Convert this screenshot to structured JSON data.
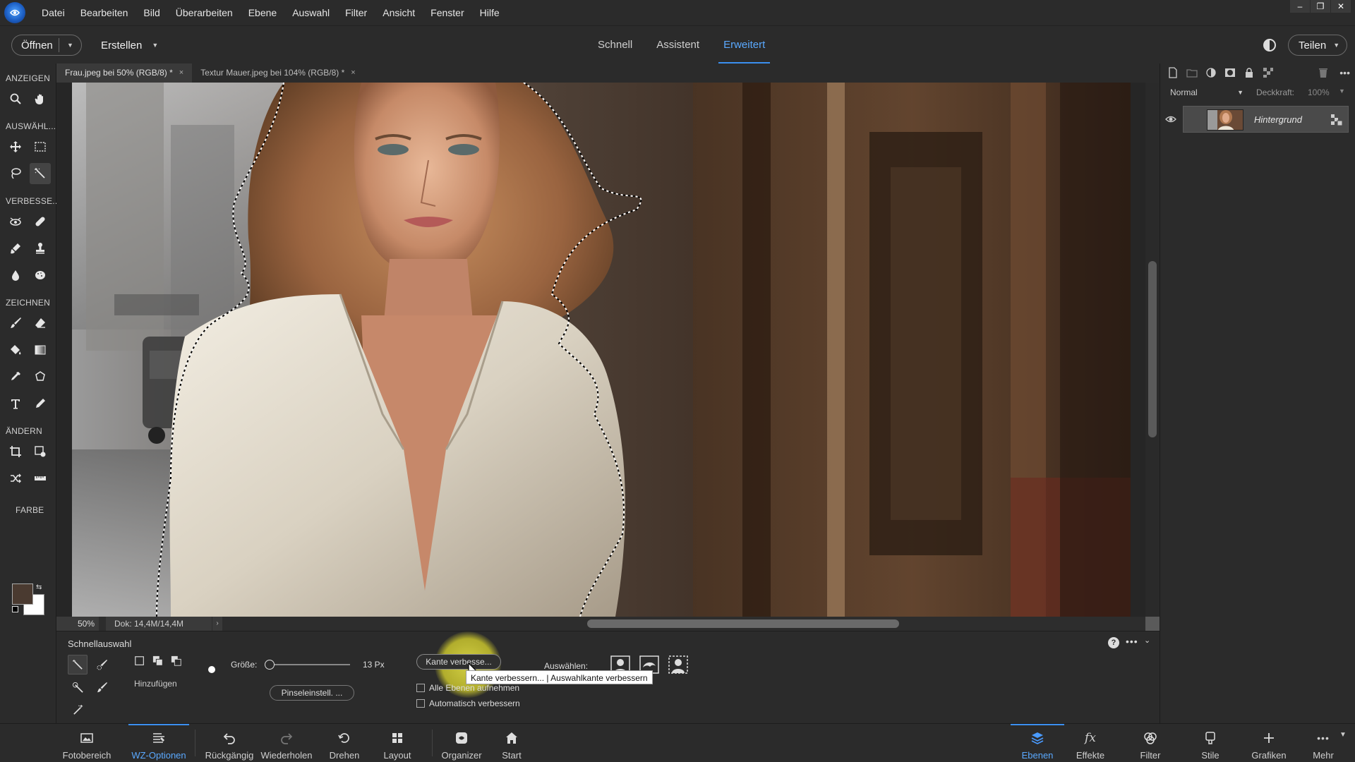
{
  "menubar": {
    "items": [
      "Datei",
      "Bearbeiten",
      "Bild",
      "Überarbeiten",
      "Ebene",
      "Auswahl",
      "Filter",
      "Ansicht",
      "Fenster",
      "Hilfe"
    ],
    "window_controls": [
      "–",
      "❐",
      "✕"
    ]
  },
  "modebar": {
    "open_label": "Öffnen",
    "create_label": "Erstellen",
    "tabs": [
      "Schnell",
      "Assistent",
      "Erweitert"
    ],
    "active_tab": "Erweitert",
    "share_label": "Teilen"
  },
  "toolbox": {
    "sections": [
      "ANZEIGEN",
      "AUSWÄHL...",
      "VERBESSE...",
      "ZEICHNEN",
      "ÄNDERN",
      "FARBE"
    ],
    "foreground_color": "#4a3a30",
    "background_color": "#ffffff"
  },
  "doc_tabs": [
    {
      "label": "Frau.jpeg bei 50% (RGB/8) *",
      "close": "×"
    },
    {
      "label": "Textur Mauer.jpeg bei 104% (RGB/8) *",
      "close": "×"
    }
  ],
  "status": {
    "zoom": "50%",
    "doc_size": "Dok: 14,4M/14,4M",
    "arrow": "›"
  },
  "tool_options": {
    "tool_name": "Schnellauswahl",
    "add_label": "Hinzufügen",
    "size_label": "Größe:",
    "size_value": "13 Px",
    "size_fraction": 0.05,
    "brush_settings_label": "Pinseleinstell. ...",
    "refine_edge_label": "Kante verbesse...",
    "tooltip": "Kante verbessern... | Auswahlkante verbessern",
    "sample_all_layers": "Alle Ebenen aufnehmen",
    "auto_enhance": "Automatisch verbessern",
    "select_label": "Auswählen:",
    "help": "?",
    "more": "•••",
    "collapse": "⌄"
  },
  "layers": {
    "blend_mode": "Normal",
    "opacity_label": "Deckkraft:",
    "opacity_value": "100%",
    "layer_name": "Hintergrund"
  },
  "bottombar": {
    "items": [
      {
        "label": "Fotobereich"
      },
      {
        "label": "WZ-Optionen"
      },
      {
        "label": "Rückgängig"
      },
      {
        "label": "Wiederholen"
      },
      {
        "label": "Drehen"
      },
      {
        "label": "Layout"
      },
      {
        "label": "Organizer"
      },
      {
        "label": "Start"
      },
      {
        "label": "Ebenen"
      },
      {
        "label": "Effekte"
      },
      {
        "label": "Filter"
      },
      {
        "label": "Stile"
      },
      {
        "label": "Grafiken"
      },
      {
        "label": "Mehr"
      }
    ],
    "active_left": "WZ-Optionen",
    "active_right": "Ebenen"
  },
  "colors": {
    "accent": "#3b8ff0",
    "panel": "#2b2b2b",
    "highlight": "#e4e046"
  }
}
